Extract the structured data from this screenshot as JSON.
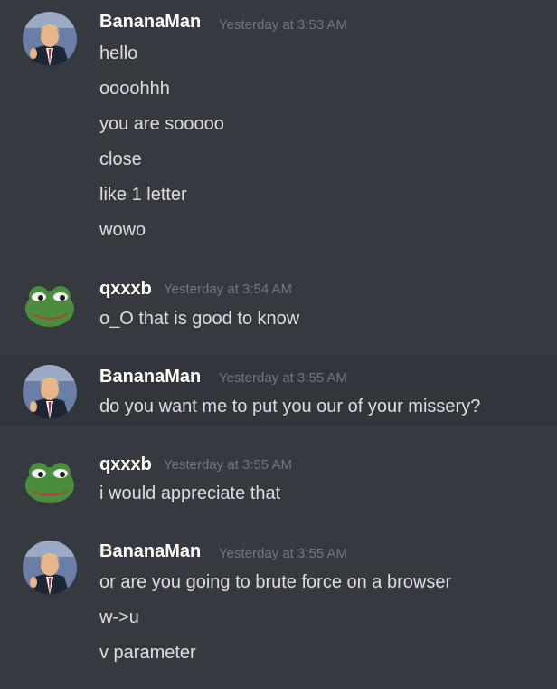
{
  "messages": [
    {
      "author": "BananaMan",
      "avatar": "trump-avatar-icon",
      "timestamp": "Yesterday at 3:53 AM",
      "lines": [
        "hello",
        "oooohhh",
        "you are sooooo",
        "close",
        "like 1 letter",
        "wowo"
      ]
    },
    {
      "author": "qxxxb",
      "avatar": "pepe-frog-avatar-icon",
      "timestamp": "Yesterday at 3:54 AM",
      "lines": [
        "o_O that is good to know"
      ]
    },
    {
      "author": "BananaMan",
      "avatar": "trump-avatar-icon",
      "timestamp": "Yesterday at 3:55 AM",
      "lines": [
        "do you want me to put you our of your missery?"
      ]
    },
    {
      "author": "qxxxb",
      "avatar": "pepe-frog-avatar-icon",
      "timestamp": "Yesterday at 3:55 AM",
      "lines": [
        "i would appreciate that"
      ]
    },
    {
      "author": "BananaMan",
      "avatar": "trump-avatar-icon",
      "timestamp": "Yesterday at 3:55 AM",
      "lines": [
        "or are you going to brute force on a browser",
        "w->u",
        "v parameter"
      ]
    }
  ],
  "colors": {
    "background": "#36393f",
    "hover_background": "#32353b",
    "username": "#ffffff",
    "timestamp": "#72767d",
    "message_text": "#dcddde"
  }
}
